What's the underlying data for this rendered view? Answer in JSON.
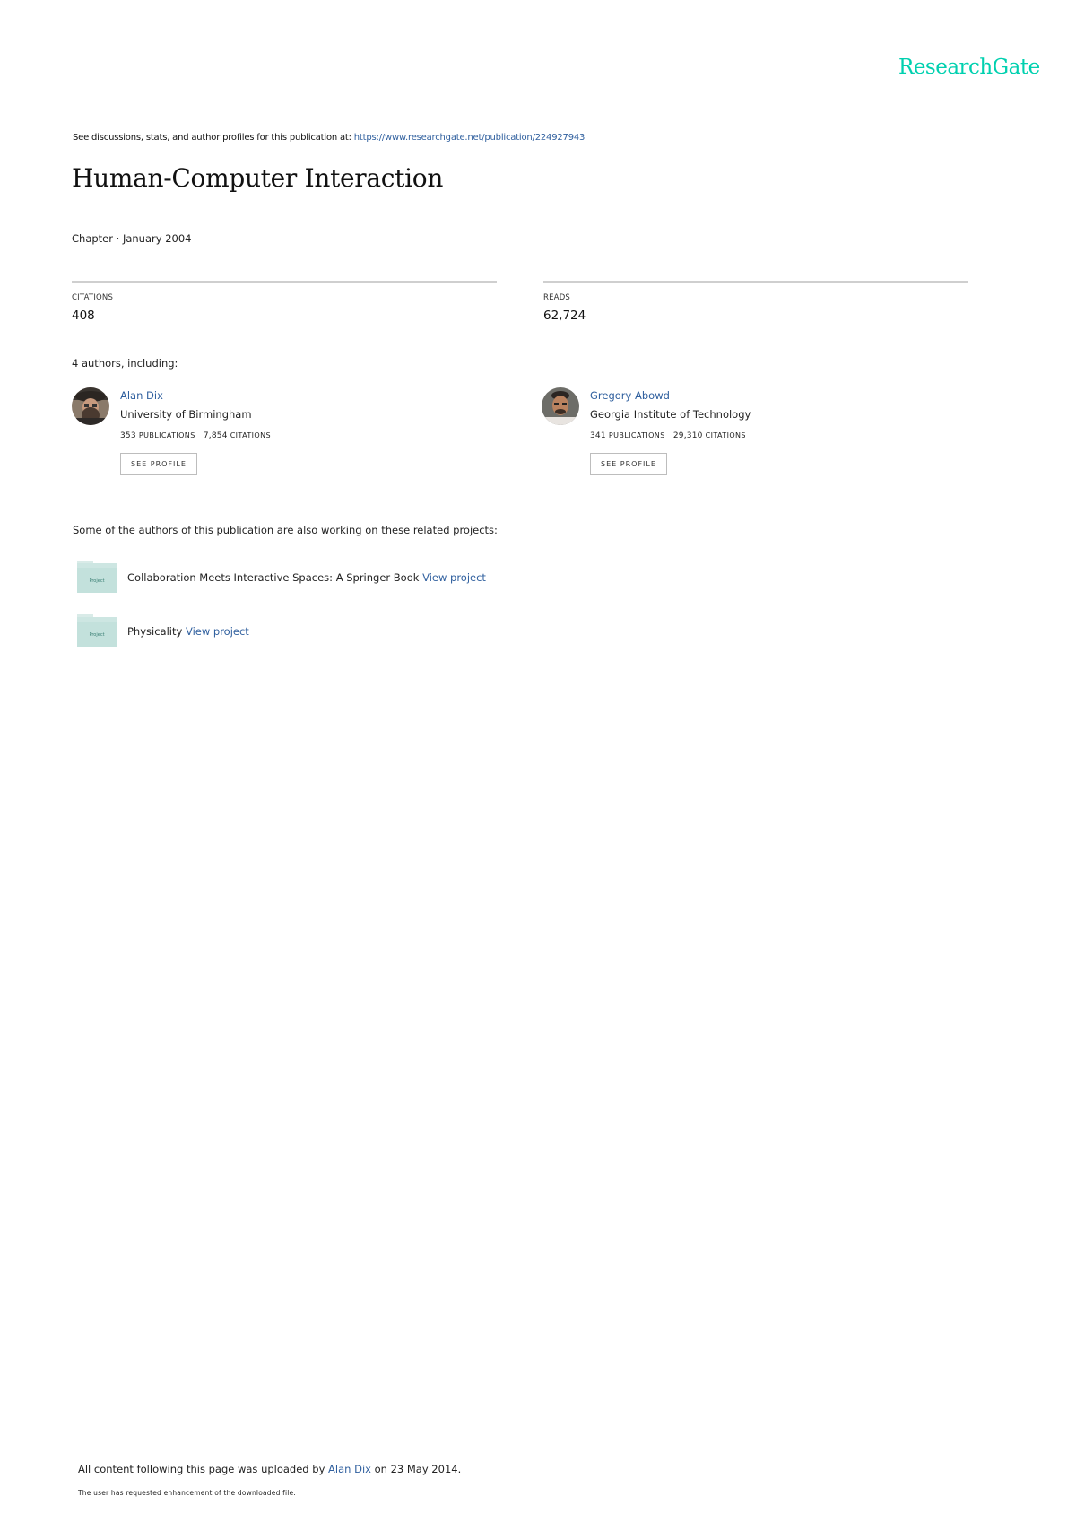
{
  "brand": {
    "logo_text": "ResearchGate",
    "logo_color": "#00d0af"
  },
  "header": {
    "see_discussions_prefix": "See discussions, stats, and author profiles for this publication at: ",
    "publication_url": "https://www.researchgate.net/publication/224927943"
  },
  "publication": {
    "title": "Human-Computer Interaction",
    "meta": "Chapter · January 2004"
  },
  "stats": {
    "citations_label": "CITATIONS",
    "citations_value": "408",
    "reads_label": "READS",
    "reads_value": "62,724"
  },
  "authors_heading": "4 authors, including:",
  "authors": [
    {
      "name": "Alan Dix",
      "institution": "University of Birmingham",
      "publications_count": "353",
      "publications_label": "PUBLICATIONS",
      "citations_count": "7,854",
      "citations_label": "CITATIONS",
      "button_label": "SEE PROFILE"
    },
    {
      "name": "Gregory Abowd",
      "institution": "Georgia Institute of Technology",
      "publications_count": "341",
      "publications_label": "PUBLICATIONS",
      "citations_count": "29,310",
      "citations_label": "CITATIONS",
      "button_label": "SEE PROFILE"
    }
  ],
  "projects_heading": "Some of the authors of this publication are also working on these related projects:",
  "projects": [
    {
      "name": "Collaboration Meets Interactive Spaces: A Springer Book",
      "link_label": "View project",
      "icon": "project-folder-icon"
    },
    {
      "name": "Physicality",
      "link_label": "View project",
      "icon": "project-folder-icon"
    }
  ],
  "footer": {
    "uploaded_prefix": "All content following this page was uploaded by ",
    "uploader": "Alan Dix",
    "uploaded_suffix": " on 23 May 2014.",
    "enhancement_note": "The user has requested enhancement of the downloaded file."
  }
}
